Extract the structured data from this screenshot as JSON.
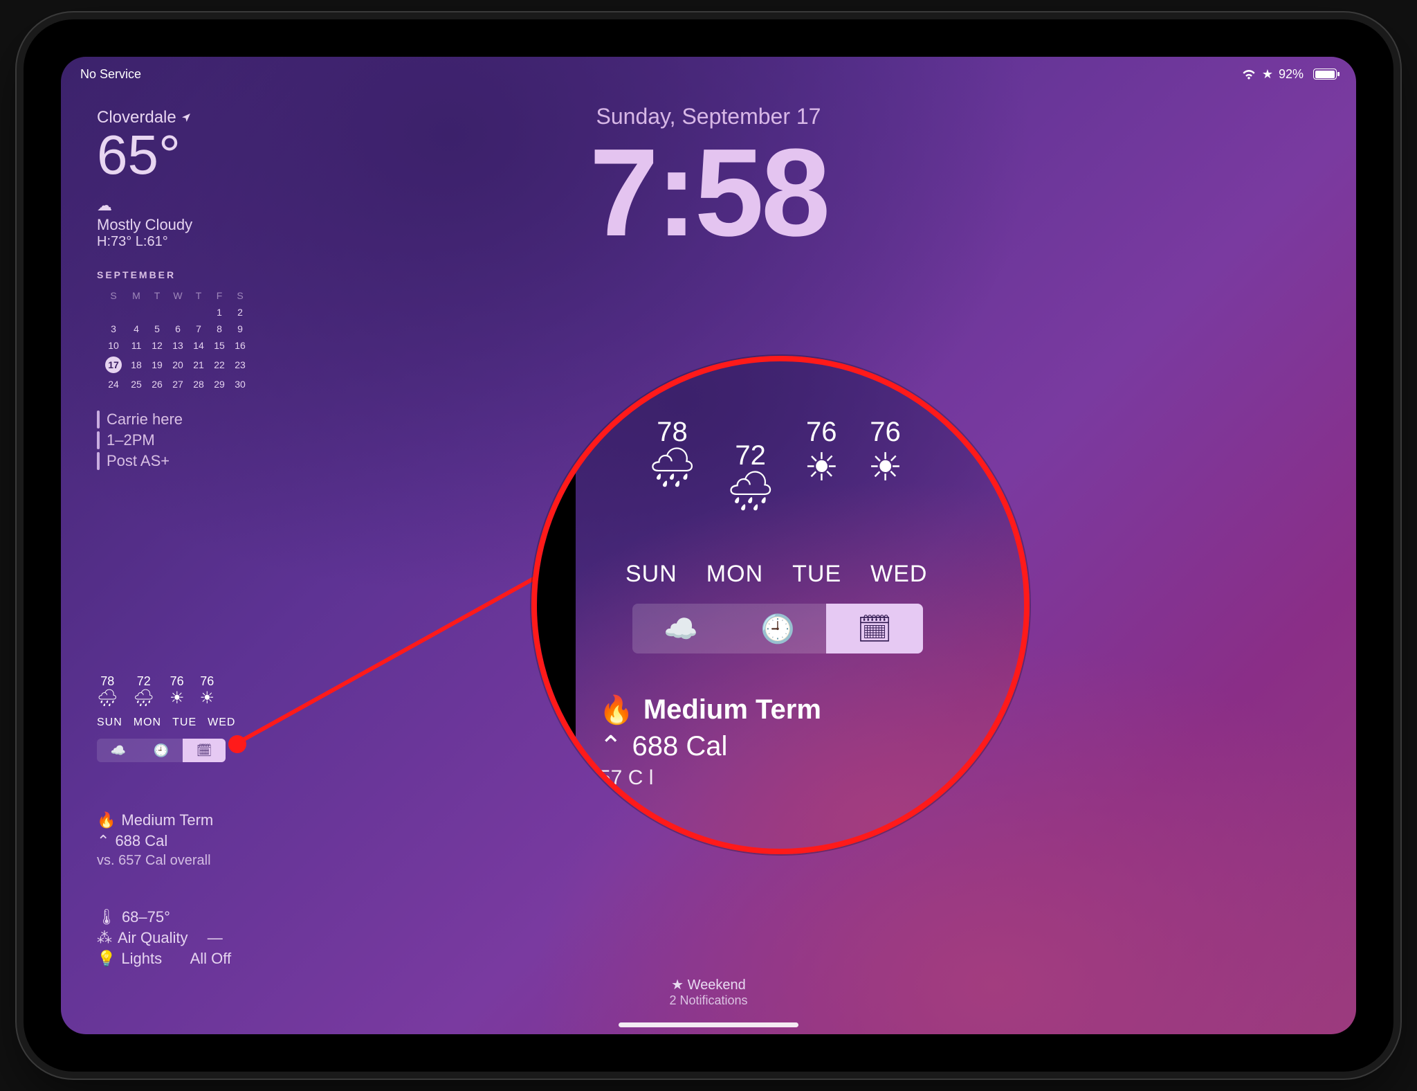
{
  "status": {
    "cellular": "No Service",
    "focus_star": "★",
    "battery_pct": "92%"
  },
  "lock": {
    "date": "Sunday, September 17",
    "time": "7:58"
  },
  "weather": {
    "location": "Cloverdale",
    "temp": "65°",
    "conditions": "Mostly Cloudy",
    "high_low": "H:73° L:61°"
  },
  "calendar": {
    "month_label": "SEPTEMBER",
    "day_headers": [
      "S",
      "M",
      "T",
      "W",
      "T",
      "F",
      "S"
    ],
    "weeks": [
      [
        "",
        "",
        "",
        "",
        "",
        "1",
        "2"
      ],
      [
        "3",
        "4",
        "5",
        "6",
        "7",
        "8",
        "9"
      ],
      [
        "10",
        "11",
        "12",
        "13",
        "14",
        "15",
        "16"
      ],
      [
        "17",
        "18",
        "19",
        "20",
        "21",
        "22",
        "23"
      ],
      [
        "24",
        "25",
        "26",
        "27",
        "28",
        "29",
        "30"
      ]
    ],
    "today": "17"
  },
  "events": [
    {
      "title": "Carrie here"
    },
    {
      "title": "1–2PM"
    },
    {
      "title": "Post AS+"
    }
  ],
  "forecast": {
    "days": [
      "SUN",
      "MON",
      "TUE",
      "WED"
    ],
    "temps": [
      "78",
      "72",
      "76",
      "76"
    ],
    "icons": [
      "rain",
      "rain",
      "sun",
      "sun"
    ],
    "segments": [
      "night",
      "hour",
      "day"
    ],
    "active_segment_index": 2
  },
  "fitness": {
    "title": "Medium Term",
    "calories": "688 Cal",
    "vs": "vs. 657 Cal overall"
  },
  "home": {
    "temp_range": "68–75°",
    "air_quality_label": "Air Quality",
    "air_quality_value": "—",
    "lights_label": "Lights",
    "lights_value": "All Off"
  },
  "bottom": {
    "focus": "Weekend",
    "notifications": "2 Notifications"
  },
  "magnifier": {
    "fitness_vs_partial": "57 C l"
  }
}
